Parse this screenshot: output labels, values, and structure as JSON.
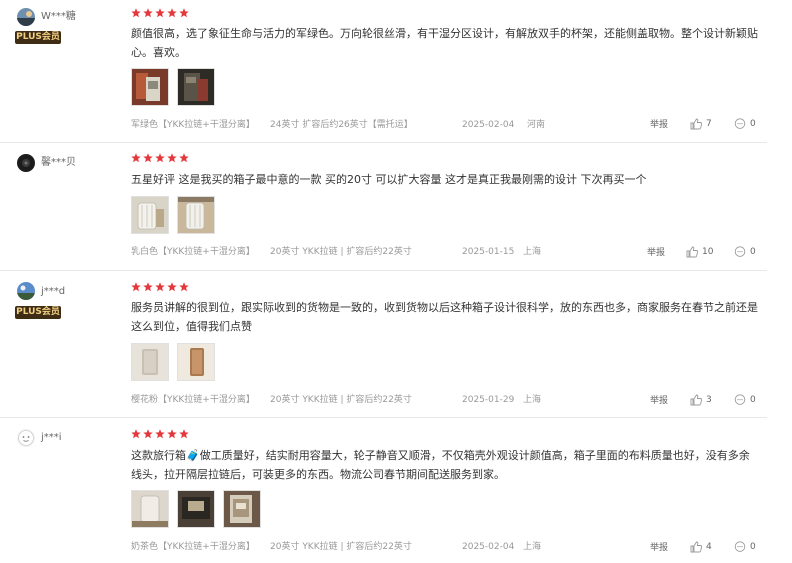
{
  "reviews": [
    {
      "user": "W***糖",
      "plus": "PLUS会员",
      "rating": 5,
      "text": "颜值很高，选了象征生命与活力的军绿色。万向轮很丝滑，有干湿分区设计，有解放双手的杯架，还能侧盖取物。整个设计新颖贴心。喜欢。",
      "color_spec": "军绿色【YKK拉链+干湿分离】",
      "size_spec": "24英寸 扩容后约26英寸【需托运】",
      "date": "2025-02-04",
      "location": "河南",
      "report": "举报",
      "likes": "7",
      "comments": "0"
    },
    {
      "user": "馨***贝",
      "plus": "",
      "rating": 5,
      "text": "五星好评 这是我买的箱子最中意的一款 买的20寸 可以扩大容量 这才是真正我最刚需的设计 下次再买一个",
      "color_spec": "乳白色【YKK拉链+干湿分离】",
      "size_spec": "20英寸 YKK拉链 | 扩容后约22英寸",
      "date": "2025-01-15",
      "location": "上海",
      "report": "举报",
      "likes": "10",
      "comments": "0"
    },
    {
      "user": "j***d",
      "plus": "PLUS会员",
      "rating": 5,
      "text": "服务员讲解的很到位，跟实际收到的货物是一致的，收到货物以后这种箱子设计很科学，放的东西也多，商家服务在春节之前还是这么到位，值得我们点赞",
      "color_spec": "樱花粉【YKK拉链+干湿分离】",
      "size_spec": "20英寸 YKK拉链 | 扩容后约22英寸",
      "date": "2025-01-29",
      "location": "上海",
      "report": "举报",
      "likes": "3",
      "comments": "0"
    },
    {
      "user": "j***i",
      "plus": "",
      "rating": 5,
      "text": "这款旅行箱🧳做工质量好，结实耐用容量大，轮子静音又顺滑，不仅箱壳外观设计颜值高，箱子里面的布料质量也好，没有多余线头，拉开隔层拉链后，可装更多的东西。物流公司春节期间配送服务到家。",
      "color_spec": "奶茶色【YKK拉链+干湿分离】",
      "size_spec": "20英寸 YKK拉链 | 扩容后约22英寸",
      "date": "2025-02-04",
      "location": "上海",
      "report": "举报",
      "likes": "4",
      "comments": "0"
    }
  ],
  "colors": {
    "star": "#e4393c",
    "plus_bg": "#3f2c14",
    "plus_text": "#f1cf83",
    "meta_text": "#999999"
  },
  "icons": {
    "like": "thumbs-up-icon",
    "comment": "comment-bubble-icon",
    "star": "star-icon"
  }
}
